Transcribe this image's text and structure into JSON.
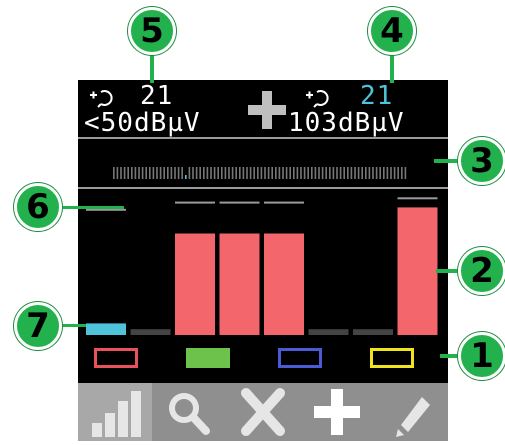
{
  "header": {
    "left_channel": "21",
    "left_level": "<50dBµV",
    "right_channel": "21",
    "right_level": "103dBµV"
  },
  "channel_buttons": [
    {
      "name": "red",
      "color": "#e8525a",
      "style": "outline"
    },
    {
      "name": "green",
      "color": "#6cc24a",
      "style": "filled"
    },
    {
      "name": "blue",
      "color": "#4a5bd6",
      "style": "outline"
    },
    {
      "name": "yellow",
      "color": "#f2e41c",
      "style": "outline"
    }
  ],
  "levels": [
    {
      "value": 0.08,
      "color": "#4fc3d9",
      "marker": 0.87
    },
    {
      "value": 0.04,
      "color": "#444444",
      "marker": null
    },
    {
      "value": 0.7,
      "color": "#f2666c",
      "marker": 0.92
    },
    {
      "value": 0.7,
      "color": "#f2666c",
      "marker": 0.92
    },
    {
      "value": 0.7,
      "color": "#f2666c",
      "marker": 0.92
    },
    {
      "value": 0.04,
      "color": "#444444",
      "marker": null
    },
    {
      "value": 0.04,
      "color": "#444444",
      "marker": null
    },
    {
      "value": 0.88,
      "color": "#f2666c",
      "marker": 0.95
    }
  ],
  "scan_marker_fraction": 0.25,
  "toolbar": [
    "bar-chart-icon",
    "search-icon",
    "delete-icon",
    "add-icon",
    "edit-icon"
  ],
  "callouts": [
    "1",
    "2",
    "3",
    "4",
    "5",
    "6",
    "7"
  ],
  "colors": {
    "accent_cyan": "#4fc3d9",
    "callout_green": "#22b14c"
  }
}
